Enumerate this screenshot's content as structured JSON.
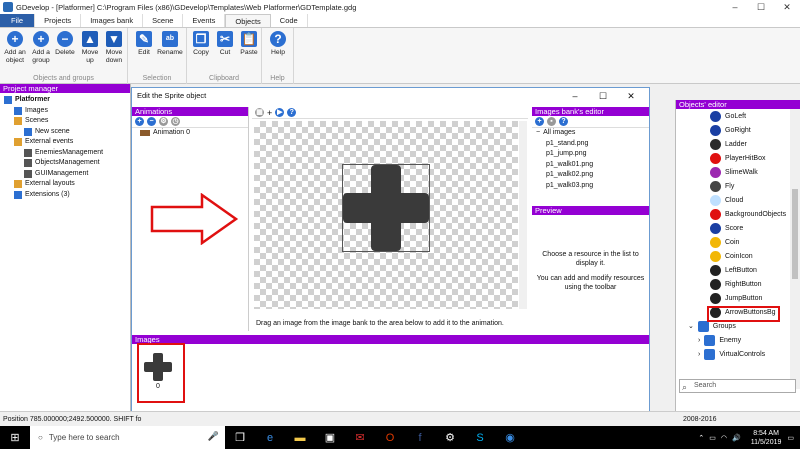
{
  "window": {
    "title": "GDevelop - [Platformer] C:\\Program Files (x86)\\GDevelop\\Templates\\Web Platformer\\GDTemplate.gdg",
    "controls": [
      "–",
      "☐",
      "✕"
    ]
  },
  "ribbon": {
    "tabs": [
      "File",
      "Projects",
      "Images bank",
      "Scene",
      "Events",
      "Objects",
      "Code"
    ],
    "active_tab": "Objects",
    "groups": [
      {
        "name": "Objects and groups",
        "buttons": [
          "Add an object",
          "Add a group",
          "Delete",
          "Move up",
          "Move down"
        ]
      },
      {
        "name": "Selection",
        "buttons": [
          "Edit",
          "Rename"
        ]
      },
      {
        "name": "Clipboard",
        "buttons": [
          "Copy",
          "Cut",
          "Paste"
        ]
      },
      {
        "name": "Help",
        "buttons": [
          "Help"
        ]
      }
    ]
  },
  "project_manager": {
    "header": "Project manager",
    "tree": [
      {
        "label": "Platformer",
        "level": 0,
        "bold": true,
        "icon": "project-icon"
      },
      {
        "label": "Images",
        "level": 1,
        "icon": "images-icon"
      },
      {
        "label": "Scenes",
        "level": 1,
        "icon": "scenes-icon"
      },
      {
        "label": "New scene",
        "level": 2,
        "icon": "scene-icon"
      },
      {
        "label": "External events",
        "level": 1,
        "icon": "events-icon"
      },
      {
        "label": "EnemiesManagement",
        "level": 2,
        "icon": "event-icon"
      },
      {
        "label": "ObjectsManagement",
        "level": 2,
        "icon": "event-icon"
      },
      {
        "label": "GUIManagement",
        "level": 2,
        "icon": "event-icon"
      },
      {
        "label": "External layouts",
        "level": 1,
        "icon": "layout-icon"
      },
      {
        "label": "Extensions (3)",
        "level": 1,
        "icon": "extensions-icon"
      }
    ]
  },
  "sprite_dialog": {
    "title": "Edit the Sprite object",
    "animations_header": "Animations",
    "animation_item": "Animation 0",
    "hint": "Drag an image from the image bank to the area below to add it to the animation.",
    "images_header": "Images",
    "image_index": "0",
    "bank_header": "Images bank's editor",
    "bank_root": "All images",
    "bank_images": [
      "p1_stand.png",
      "p1_jump.png",
      "p1_walk01.png",
      "p1_walk02.png",
      "p1_walk03.png"
    ],
    "preview_header": "Preview",
    "preview_text1": "Choose a resource in the list to display it.",
    "preview_text2": "You can add and modify resources using the toolbar"
  },
  "objects_editor": {
    "header": "Objects' editor",
    "objects": [
      {
        "label": "GoLeft",
        "color": "#1a3fa3"
      },
      {
        "label": "GoRight",
        "color": "#1a3fa3"
      },
      {
        "label": "Ladder",
        "color": "#2a2a2a"
      },
      {
        "label": "PlayerHitBox",
        "color": "#e01010"
      },
      {
        "label": "SlimeWalk",
        "color": "#9c27b0"
      },
      {
        "label": "Fly",
        "color": "#444444"
      },
      {
        "label": "Cloud",
        "color": "#bfe0ff"
      },
      {
        "label": "BackgroundObjects",
        "color": "#e01010"
      },
      {
        "label": "Score",
        "color": "#1a3fa3"
      },
      {
        "label": "Coin",
        "color": "#f2b705"
      },
      {
        "label": "CoinIcon",
        "color": "#f2b705"
      },
      {
        "label": "LeftButton",
        "color": "#222222"
      },
      {
        "label": "RightButton",
        "color": "#222222"
      },
      {
        "label": "JumpButton",
        "color": "#222222"
      },
      {
        "label": "ArrowButtonsBg",
        "color": "#222222"
      }
    ],
    "groups_label": "Groups",
    "groups": [
      "Enemy",
      "VirtualControls"
    ],
    "search_placeholder": "Search"
  },
  "status": {
    "position": "Position 785.000000;2492.500000. SHIFT fo",
    "years": "2008-2016"
  },
  "taskbar": {
    "search_placeholder": "Type here to search",
    "time": "8:54 AM",
    "date": "11/5/2019"
  },
  "colors": {
    "accent_purple": "#9400d3",
    "file_tab_blue": "#2c5fa8",
    "highlight_red": "#e01010"
  }
}
